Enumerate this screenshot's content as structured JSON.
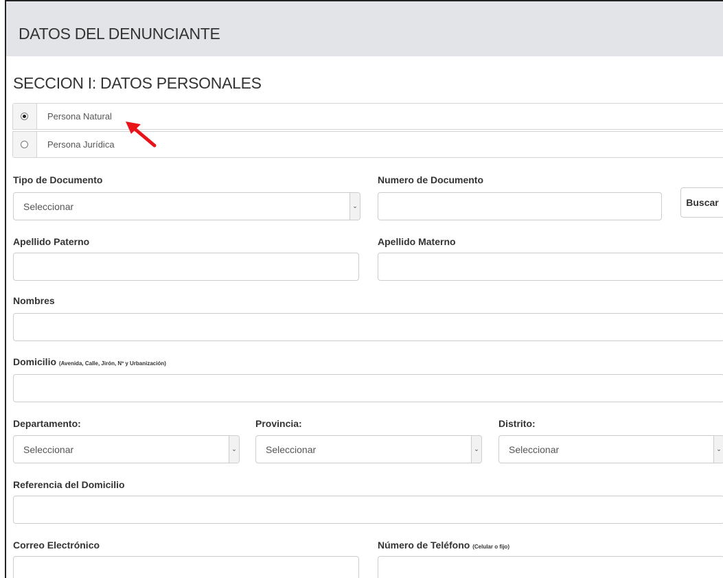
{
  "header": {
    "title": "DATOS DEL DENUNCIANTE"
  },
  "section": {
    "title": "SECCION I: DATOS PERSONALES"
  },
  "person_type": {
    "options": [
      {
        "label": "Persona Natural",
        "checked": true
      },
      {
        "label": "Persona Jurídica",
        "checked": false
      }
    ]
  },
  "form": {
    "tipo_documento": {
      "label": "Tipo de Documento",
      "value": "Seleccionar"
    },
    "numero_documento": {
      "label": "Numero de Documento",
      "value": ""
    },
    "buscar_button": "Buscar",
    "apellido_paterno": {
      "label": "Apellido Paterno",
      "value": ""
    },
    "apellido_materno": {
      "label": "Apellido Materno",
      "value": ""
    },
    "nombres": {
      "label": "Nombres",
      "value": ""
    },
    "domicilio": {
      "label": "Domicilio",
      "hint": "(Avenida, Calle, Jirón, Nº y Urbanización)",
      "value": ""
    },
    "departamento": {
      "label": "Departamento:",
      "value": "Seleccionar"
    },
    "provincia": {
      "label": "Provincia:",
      "value": "Seleccionar"
    },
    "distrito": {
      "label": "Distrito:",
      "value": "Seleccionar"
    },
    "referencia": {
      "label": "Referencia del Domicilio",
      "value": ""
    },
    "correo": {
      "label": "Correo Electrónico",
      "value": ""
    },
    "telefono": {
      "label": "Número de Teléfono",
      "hint": "(Celular o fijo)",
      "value": ""
    }
  },
  "annotation": {
    "arrow_color": "#e8141a"
  }
}
